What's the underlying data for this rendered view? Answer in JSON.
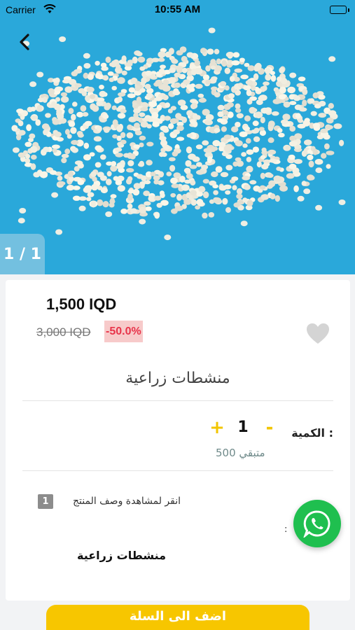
{
  "status_bar": {
    "carrier": "Carrier",
    "time": "10:55 AM"
  },
  "hero": {
    "counter": "1 / 1"
  },
  "product": {
    "price": "1,500 IQD",
    "old_price": "3,000 IQD",
    "discount": "-50.0%",
    "title": "منشطات زراعية",
    "subtitle": "منشطات زراعية"
  },
  "quantity": {
    "label": "الكمية :",
    "value": "1",
    "plus": "+",
    "minus": "-",
    "stock": "متبقي 500"
  },
  "description": {
    "badge": "1",
    "link": "انقر لمشاهدة وصف المنتج",
    "colon": ":"
  },
  "cta": {
    "label": "اضف الى السلة"
  },
  "colors": {
    "accent": "#f7c600",
    "discount_text": "#e8344a",
    "discount_bg": "#f7caca",
    "whatsapp": "#1fbf4f",
    "hero_bg": "#2aa8da"
  },
  "icons": {
    "back": "chevron-left-icon",
    "favorite": "heart-icon",
    "whatsapp": "whatsapp-icon",
    "wifi": "wifi-icon",
    "battery": "battery-icon"
  }
}
